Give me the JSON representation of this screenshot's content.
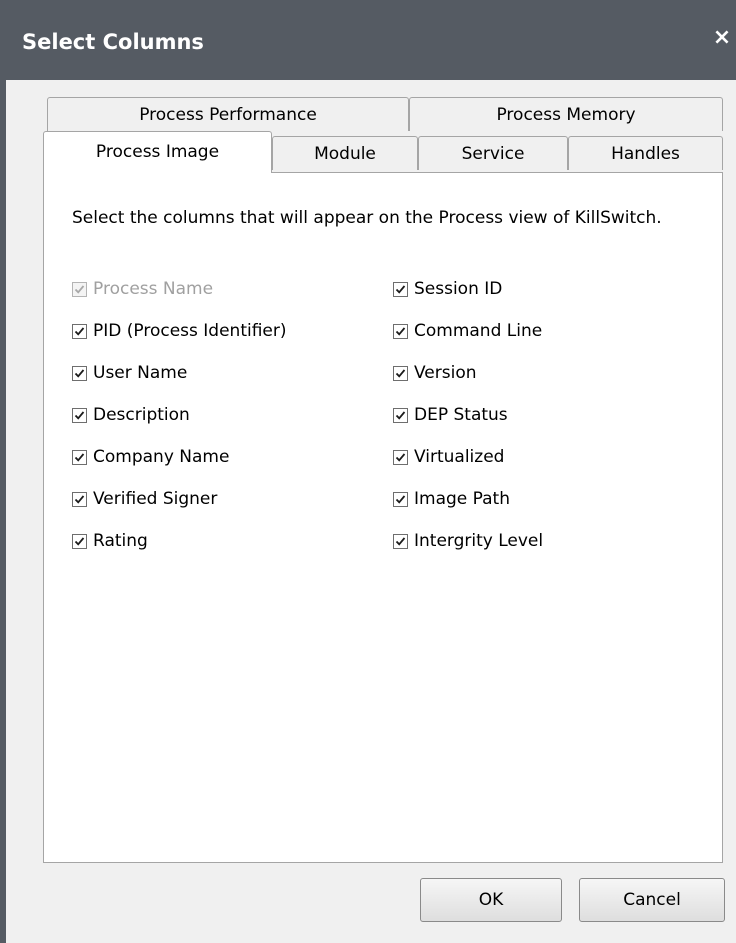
{
  "dialog": {
    "title": "Select Columns",
    "close_glyph": "×"
  },
  "tabs": {
    "row_back": [
      "Process Performance",
      "Process Memory"
    ],
    "row_front": [
      "Process Image",
      "Module",
      "Service",
      "Handles"
    ],
    "active": "Process Image"
  },
  "panel": {
    "description": "Select the columns that will appear on the Process view of KillSwitch.",
    "left_column": [
      {
        "label": "Process Name",
        "checked": true,
        "disabled": true
      },
      {
        "label": "PID (Process Identifier)",
        "checked": true,
        "disabled": false
      },
      {
        "label": "User Name",
        "checked": true,
        "disabled": false
      },
      {
        "label": "Description",
        "checked": true,
        "disabled": false
      },
      {
        "label": "Company Name",
        "checked": true,
        "disabled": false
      },
      {
        "label": "Verified Signer",
        "checked": true,
        "disabled": false
      },
      {
        "label": "Rating",
        "checked": true,
        "disabled": false
      }
    ],
    "right_column": [
      {
        "label": "Session ID",
        "checked": true,
        "disabled": false
      },
      {
        "label": "Command Line",
        "checked": true,
        "disabled": false
      },
      {
        "label": "Version",
        "checked": true,
        "disabled": false
      },
      {
        "label": "DEP Status",
        "checked": true,
        "disabled": false
      },
      {
        "label": "Virtualized",
        "checked": true,
        "disabled": false
      },
      {
        "label": "Image Path",
        "checked": true,
        "disabled": false
      },
      {
        "label": "Intergrity Level",
        "checked": true,
        "disabled": false
      }
    ]
  },
  "buttons": {
    "ok": "OK",
    "cancel": "Cancel"
  },
  "colors": {
    "titlebar": "#555b63",
    "check_enabled": "#1b1b1b",
    "check_disabled": "#a8a8a8"
  }
}
